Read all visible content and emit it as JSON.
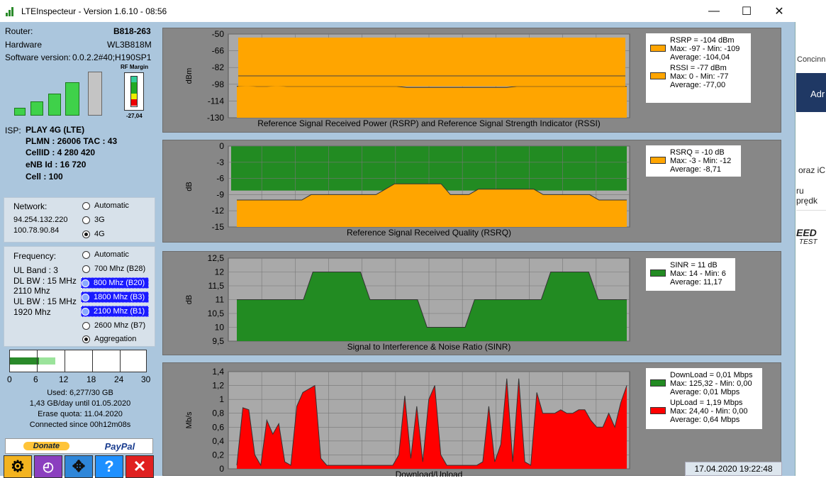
{
  "window": {
    "title": "LTEInspecteur - Version 1.6.10 - 08:56"
  },
  "router": {
    "router_label": "Router:",
    "router_value": "B818-263",
    "hardware_label": "Hardware",
    "hardware_value": "WL3B818M",
    "software_label": "Software version:",
    "software_value": "0.0.2.2#40;H190SP1",
    "rf_margin_label": "RF Margin",
    "rf_margin_value": "-27,04"
  },
  "isp": {
    "label": "ISP:",
    "name": "PLAY 4G (LTE)",
    "plmn": "PLMN : 26006 TAC : 43",
    "cellid": "CellID : 4 280 420",
    "enb": "eNB Id : 16 720",
    "cell": "Cell : 100"
  },
  "network": {
    "label": "Network:",
    "ip1": "94.254.132.220",
    "ip2": "100.78.90.84",
    "options": [
      "Automatic",
      "3G",
      "4G"
    ],
    "selected": "4G"
  },
  "frequency": {
    "label": "Frequency:",
    "ul_band": "UL Band : 3",
    "dl_bw": "DL BW : 15 MHz",
    "dl_freq": "2110 Mhz",
    "ul_bw": "UL BW : 15 MHz",
    "ul_freq": "1920 Mhz",
    "options": [
      "Automatic",
      "700 Mhz (B28)",
      "800 Mhz (B20)",
      "1800 Mhz (B3)",
      "2100 Mhz (B1)",
      "2600 Mhz (B7)",
      "Aggregation"
    ]
  },
  "usage": {
    "axis_ticks": [
      "0",
      "6",
      "12",
      "18",
      "24",
      "30"
    ],
    "used": "Used: 6,277/30 GB",
    "per_day": "1,43 GB/day until 01.05.2020",
    "erase": "Erase quota: 11.04.2020",
    "connected": "Connected since 00h12m08s",
    "used_fraction": 0.209,
    "projected_fraction": 0.33
  },
  "buttons": {
    "donate": "Donate",
    "paypal": "PayPal",
    "help": "?",
    "close": "✕"
  },
  "timestamp": "17.04.2020 19:22:48",
  "colors": {
    "orange": "#ffa500",
    "green": "#228b22",
    "red": "#ff0000",
    "plot_bg": "#a9a9a9",
    "panel": "#878787"
  },
  "chart_data": [
    {
      "type": "area",
      "title": "Reference Signal Received Power (RSRP) and Reference Signal Strength Indicator (RSSI)",
      "ylabel": "dBm",
      "ylim": [
        -130,
        -50
      ],
      "yticks": [
        "-50",
        "-66",
        "-82",
        "-98",
        "-114",
        "-130"
      ],
      "series": [
        {
          "name": "RSSI",
          "color": "#ffa500",
          "values": [
            -100,
            -99.5,
            -100,
            -100,
            -99.5,
            -100,
            -100,
            -100,
            -100,
            -100,
            -100,
            -100,
            -100,
            -100,
            -100,
            -100,
            -100,
            -101,
            -101,
            -101,
            -101,
            -101,
            -101,
            -101,
            -101,
            -101,
            -101,
            -101,
            -100,
            -100,
            -100,
            -100,
            -100,
            -100,
            -100,
            -100,
            -100,
            -100,
            -100,
            -100
          ]
        }
      ],
      "legend": [
        {
          "color": "#ffa500",
          "lines": [
            "RSRP = -104 dBm",
            "Max: -97 - Min: -109",
            "Average: -104,04"
          ]
        },
        {
          "color": "#ffa500",
          "lines": [
            "RSSI = -77 dBm",
            "Max: 0 - Min: -77",
            "Average: -77,00"
          ]
        }
      ]
    },
    {
      "type": "area",
      "title": "Reference Signal Received Quality (RSRQ)",
      "ylabel": "dB",
      "ylim": [
        -15,
        0
      ],
      "yticks": [
        "0",
        "-3",
        "-6",
        "-9",
        "-12",
        "-15"
      ],
      "series": [
        {
          "name": "RSRQ",
          "color": "#ffa500",
          "values": [
            -10,
            -10,
            -10,
            -10,
            -10,
            -10,
            -10,
            -10,
            -9,
            -9,
            -9,
            -9,
            -9,
            -9,
            -9,
            -9,
            -8,
            -7,
            -7,
            -7,
            -7,
            -7,
            -7,
            -9,
            -9,
            -9,
            -8,
            -8,
            -8,
            -8,
            -8,
            -8,
            -8,
            -9,
            -9,
            -9,
            -9,
            -9,
            -9,
            -10,
            -10,
            -10,
            -10
          ]
        }
      ],
      "legend": [
        {
          "color": "#ffa500",
          "lines": [
            "RSRQ = -10 dB",
            "Max: -3 - Min: -12",
            "Average: -8,71"
          ]
        }
      ]
    },
    {
      "type": "area",
      "title": "Signal to Interference & Noise Ratio (SINR)",
      "ylabel": "dB",
      "ylim": [
        9.5,
        12.5
      ],
      "yticks": [
        "12,5",
        "12",
        "11,5",
        "11",
        "10,5",
        "10",
        "9,5"
      ],
      "series": [
        {
          "name": "SINR",
          "color": "#228b22",
          "values": [
            11,
            11,
            11,
            11,
            11,
            11,
            11,
            11,
            12,
            12,
            12,
            12,
            12,
            12,
            11,
            11,
            11,
            11,
            11,
            11,
            10,
            10,
            10,
            10,
            10,
            11,
            11,
            11,
            11,
            11,
            11,
            11,
            11,
            12,
            12,
            12,
            12,
            12,
            11,
            11,
            11,
            11
          ]
        }
      ],
      "legend": [
        {
          "color": "#228b22",
          "lines": [
            "SINR = 11 dB",
            "Max: 14 - Min: 6",
            "Average: 11,17"
          ]
        }
      ]
    },
    {
      "type": "area",
      "title": "Download/Upload",
      "ylabel": "Mb/s",
      "ylim": [
        0,
        1.4
      ],
      "yticks": [
        "1,4",
        "1,2",
        "1",
        "0,8",
        "0,6",
        "0,4",
        "0,2",
        "0"
      ],
      "series": [
        {
          "name": "UpLoad",
          "color": "#ff0000",
          "values": [
            0.05,
            0.88,
            0.85,
            0.2,
            0.05,
            0.7,
            0.5,
            0.65,
            0.1,
            0.05,
            0.9,
            1.1,
            1.15,
            1.2,
            0.15,
            0.05,
            0.05,
            0.05,
            0.05,
            0.05,
            0.05,
            0.05,
            0.05,
            0.05,
            0.05,
            0.05,
            0.05,
            0.2,
            1.05,
            0.15,
            0.9,
            0.1,
            1.0,
            1.2,
            0.2,
            0.05,
            0.05,
            0.05,
            0.05,
            0.05,
            0.05,
            0.1,
            0.9,
            0.1,
            0.35,
            1.3,
            0.1,
            1.3,
            0.1,
            0.05,
            1.1,
            0.8,
            0.8,
            0.8,
            0.85,
            0.8,
            0.8,
            0.85,
            0.85,
            0.7,
            0.6,
            0.6,
            0.8,
            0.6,
            0.95,
            1.2
          ]
        }
      ],
      "legend": [
        {
          "color": "#228b22",
          "lines": [
            "DownLoad = 0,01 Mbps",
            "Max: 125,32 - Min: 0,00",
            "Average: 0,01 Mbps"
          ]
        },
        {
          "color": "#ff0000",
          "lines": [
            "UpLoad = 1,19 Mbps",
            "Max: 24,40 - Min: 0,00",
            "Average: 0,64 Mbps"
          ]
        }
      ]
    }
  ],
  "background_app": {
    "text1": "Concinn",
    "text2": "Adr",
    "text3": "oraz iC",
    "text4": "ru prędk",
    "text5": "EED",
    "text6": "TEST"
  }
}
